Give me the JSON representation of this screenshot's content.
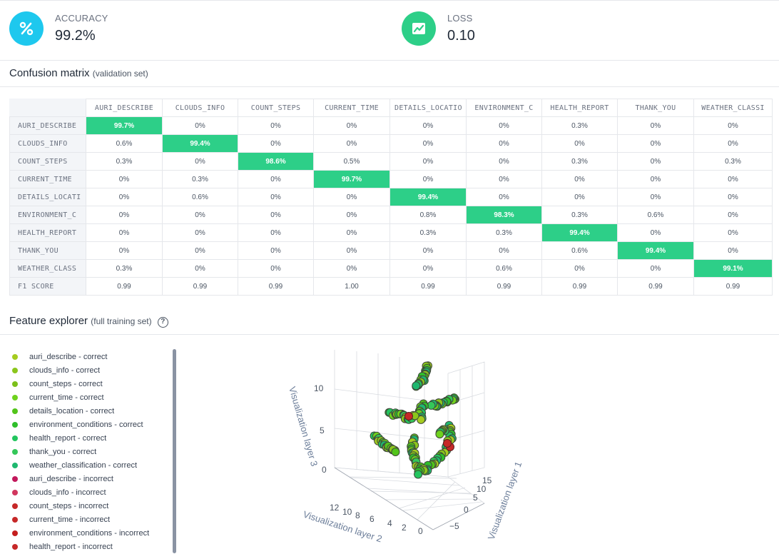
{
  "metrics": {
    "accuracy": {
      "label": "ACCURACY",
      "value": "99.2%",
      "color": "#1ec8ee",
      "icon": "percent-icon"
    },
    "loss": {
      "label": "LOSS",
      "value": "0.10",
      "color": "#2dcf88",
      "icon": "line-chart-icon"
    }
  },
  "confusion": {
    "title": "Confusion matrix",
    "subtitle": "(validation set)",
    "columns": [
      "AURI_DESCRIBE",
      "CLOUDS_INFO",
      "COUNT_STEPS",
      "CURRENT_TIME",
      "DETAILS_LOCATIO",
      "ENVIRONMENT_C",
      "HEALTH_REPORT",
      "THANK_YOU",
      "WEATHER_CLASSI"
    ],
    "rows": [
      {
        "label": "AURI_DESCRIBE",
        "cells": [
          "99.7%",
          "0%",
          "0%",
          "0%",
          "0%",
          "0%",
          "0.3%",
          "0%",
          "0%"
        ]
      },
      {
        "label": "CLOUDS_INFO",
        "cells": [
          "0.6%",
          "99.4%",
          "0%",
          "0%",
          "0%",
          "0%",
          "0%",
          "0%",
          "0%"
        ]
      },
      {
        "label": "COUNT_STEPS",
        "cells": [
          "0.3%",
          "0%",
          "98.6%",
          "0.5%",
          "0%",
          "0%",
          "0.3%",
          "0%",
          "0.3%"
        ]
      },
      {
        "label": "CURRENT_TIME",
        "cells": [
          "0%",
          "0.3%",
          "0%",
          "99.7%",
          "0%",
          "0%",
          "0%",
          "0%",
          "0%"
        ]
      },
      {
        "label": "DETAILS_LOCATI",
        "cells": [
          "0%",
          "0.6%",
          "0%",
          "0%",
          "99.4%",
          "0%",
          "0%",
          "0%",
          "0%"
        ]
      },
      {
        "label": "ENVIRONMENT_C",
        "cells": [
          "0%",
          "0%",
          "0%",
          "0%",
          "0.8%",
          "98.3%",
          "0.3%",
          "0.6%",
          "0%"
        ]
      },
      {
        "label": "HEALTH_REPORT",
        "cells": [
          "0%",
          "0%",
          "0%",
          "0%",
          "0.3%",
          "0.3%",
          "99.4%",
          "0%",
          "0%"
        ]
      },
      {
        "label": "THANK_YOU",
        "cells": [
          "0%",
          "0%",
          "0%",
          "0%",
          "0%",
          "0%",
          "0.6%",
          "99.4%",
          "0%"
        ]
      },
      {
        "label": "WEATHER_CLASS",
        "cells": [
          "0.3%",
          "0%",
          "0%",
          "0%",
          "0%",
          "0.6%",
          "0%",
          "0%",
          "99.1%"
        ]
      }
    ],
    "f1": {
      "label": "F1 SCORE",
      "cells": [
        "0.99",
        "0.99",
        "0.99",
        "1.00",
        "0.99",
        "0.99",
        "0.99",
        "0.99",
        "0.99"
      ]
    }
  },
  "explorer": {
    "title": "Feature explorer",
    "subtitle": "(full training set)",
    "help_icon": "question-circle-icon",
    "legend": [
      {
        "label": "auri_describe - correct",
        "color": "#a5cc1f"
      },
      {
        "label": "clouds_info - correct",
        "color": "#8bc61c"
      },
      {
        "label": "count_steps - correct",
        "color": "#7cc01a"
      },
      {
        "label": "current_time - correct",
        "color": "#6fd21d"
      },
      {
        "label": "details_location - correct",
        "color": "#52c41a"
      },
      {
        "label": "environment_conditions - correct",
        "color": "#2fbf2a"
      },
      {
        "label": "health_report - correct",
        "color": "#22c55e"
      },
      {
        "label": "thank_you - correct",
        "color": "#34c759"
      },
      {
        "label": "weather_classification - correct",
        "color": "#1fb86f"
      },
      {
        "label": "auri_describe - incorrect",
        "color": "#c2185b"
      },
      {
        "label": "clouds_info - incorrect",
        "color": "#d1365e"
      },
      {
        "label": "count_steps - incorrect",
        "color": "#c62828"
      },
      {
        "label": "current_time - incorrect",
        "color": "#c62828"
      },
      {
        "label": "environment_conditions - incorrect",
        "color": "#c41e1e"
      },
      {
        "label": "health_report - incorrect",
        "color": "#c62828"
      }
    ],
    "plot": {
      "axis_x_label": "Visualization layer 1",
      "axis_y_label": "Visualization layer 2",
      "axis_z_label": "Visualization layer 3",
      "x_ticks": [
        "15",
        "10",
        "5",
        "0",
        "−5"
      ],
      "y_ticks": [
        "12",
        "10",
        "8",
        "6",
        "4",
        "2",
        "0"
      ],
      "z_ticks": [
        "10",
        "5",
        "0"
      ]
    }
  }
}
